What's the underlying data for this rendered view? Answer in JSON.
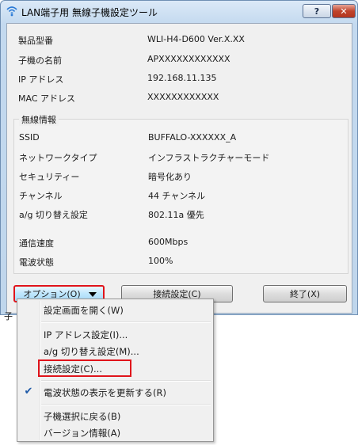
{
  "window": {
    "title": "LAN端子用 無線子機設定ツール",
    "help_label": "?",
    "close_label": "✕"
  },
  "info": [
    {
      "label": "製品型番",
      "value": "WLI-H4-D600 Ver.X.XX"
    },
    {
      "label": "子機の名前",
      "value": "APXXXXXXXXXXXX"
    },
    {
      "label": "IP アドレス",
      "value": "192.168.11.135"
    },
    {
      "label": "MAC アドレス",
      "value": "XXXXXXXXXXXX"
    }
  ],
  "wireless": {
    "title": "無線情報",
    "rows": [
      {
        "label": "SSID",
        "value": "BUFFALO-XXXXXX_A"
      },
      {
        "label": "ネットワークタイプ",
        "value": "インフラストラクチャーモード"
      },
      {
        "label": "セキュリティー",
        "value": "暗号化あり"
      },
      {
        "label": "チャンネル",
        "value": "44 チャンネル"
      },
      {
        "label": "a/g 切り替え設定",
        "value": "802.11a 優先"
      },
      {
        "label": "通信速度",
        "value": "600Mbps"
      },
      {
        "label": "電波状態",
        "value": "100%"
      }
    ]
  },
  "buttons": {
    "options": "オプション(O)",
    "connect": "接続設定(C)",
    "exit": "終了(X)"
  },
  "status_fragment": "子",
  "menu": {
    "items": [
      {
        "label": "設定画面を開く(W)",
        "checked": false
      },
      {
        "label": "IP アドレス設定(I)...",
        "checked": false
      },
      {
        "label": "a/g 切り替え設定(M)...",
        "checked": false
      },
      {
        "label": "接続設定(C)...",
        "checked": false,
        "highlighted": true
      },
      {
        "label": "電波状態の表示を更新する(R)",
        "checked": true
      },
      {
        "label": "子機選択に戻る(B)",
        "checked": false
      },
      {
        "label": "バージョン情報(A)",
        "checked": false
      }
    ]
  },
  "colors": {
    "highlight": "#e0141b",
    "accent": "#1f5aa8"
  }
}
